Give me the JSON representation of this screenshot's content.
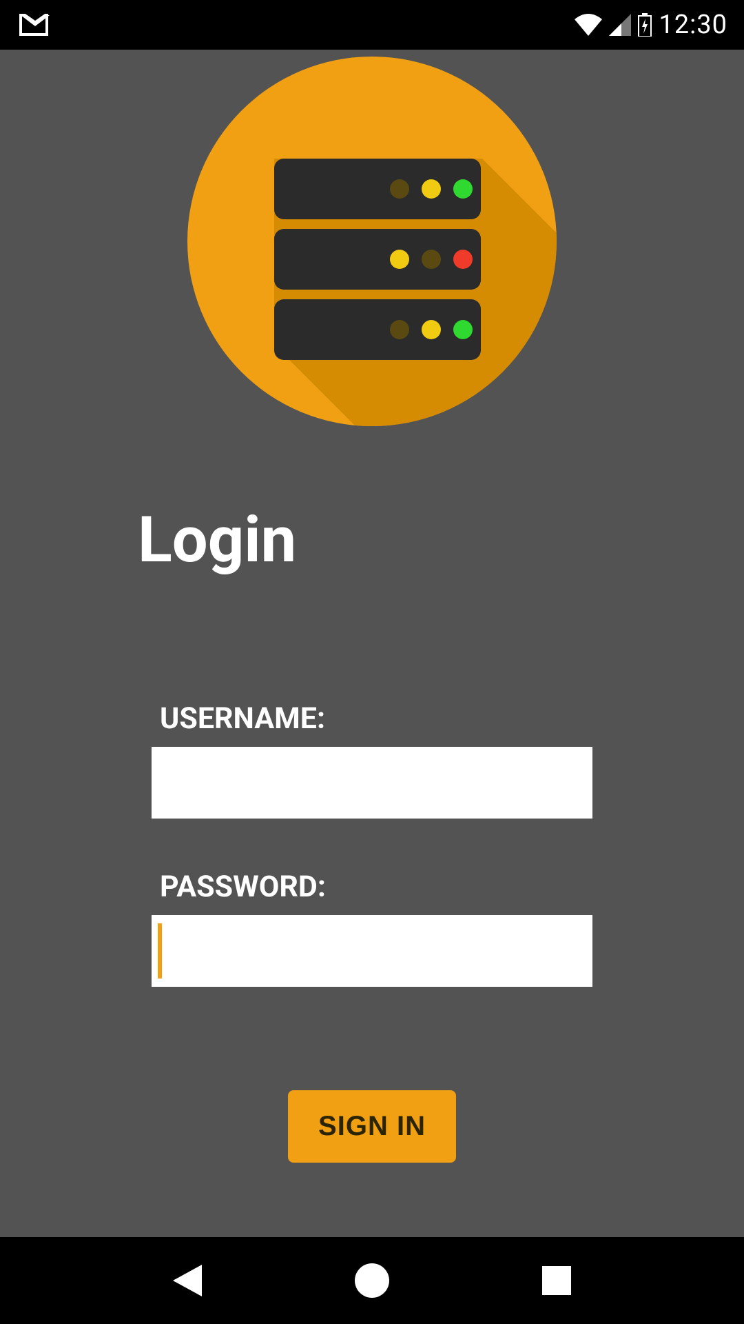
{
  "status": {
    "time": "12:30"
  },
  "page": {
    "title": "Login"
  },
  "form": {
    "username_label": "USERNAME:",
    "username_value": "",
    "password_label": "PASSWORD:",
    "password_value": "",
    "signin_label": "SIGN IN"
  },
  "colors": {
    "accent": "#f0a012",
    "bg": "#535353"
  },
  "logo": {
    "leds": [
      [
        "#5a4a12",
        "#f0cb12",
        "#2fd92f"
      ],
      [
        "#f0cb12",
        "#5a4a12",
        "#f03a2a"
      ],
      [
        "#5a4a12",
        "#f0cb12",
        "#2fd92f"
      ]
    ]
  }
}
